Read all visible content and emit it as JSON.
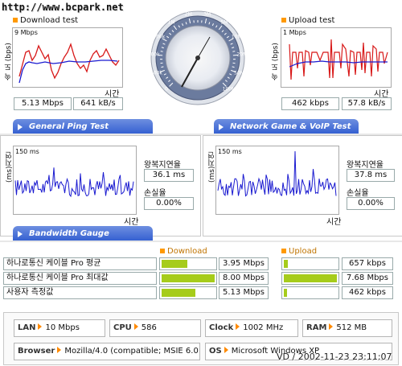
{
  "site": {
    "url": "http://www.bcpark.net"
  },
  "download": {
    "title": "Download test",
    "axis_label": "속 도 (bps)",
    "scale": "9 Mbps",
    "time_label": "시간",
    "speed_mbps": "5.13 Mbps",
    "speed_kbs": "641 kB/s"
  },
  "upload": {
    "title": "Upload test",
    "axis_label": "속 도 (bps)",
    "scale": "1 Mbps",
    "time_label": "시간",
    "speed_kbps": "462 kbps",
    "speed_kbs": "57.8 kB/s"
  },
  "gauge": {
    "ticks": [
      "0",
      "100k",
      "200k",
      "500k",
      "1M",
      "2M",
      "3M",
      "5M",
      "10M",
      "20M",
      "50M",
      "100M"
    ]
  },
  "tabs": {
    "ping": "General Ping Test",
    "game": "Network Game & VoIP Test",
    "bandwidth": "Bandwidth Gauge"
  },
  "ping_left": {
    "axis_label": "(ms)지연",
    "scale": "150 ms",
    "time_label": "시간",
    "rtt_label": "왕복지연율",
    "rtt_value": "36.1 ms",
    "loss_label": "손실율",
    "loss_value": "0.00%"
  },
  "ping_right": {
    "axis_label": "(ms)지연",
    "scale": "150 ms",
    "time_label": "시간",
    "rtt_label": "왕복지연율",
    "rtt_value": "37.8 ms",
    "loss_label": "손실율",
    "loss_value": "0.00%"
  },
  "bandwidth": {
    "download_header": "Download",
    "upload_header": "Upload",
    "rows": [
      {
        "label": "하나로통신 케이블 Pro 평균",
        "down": "3.95 Mbps",
        "down_frac": 0.49,
        "up": "657 kbps",
        "up_frac": 0.08
      },
      {
        "label": "하나로통신 케이블 Pro 최대값",
        "down": "8.00 Mbps",
        "down_frac": 1.0,
        "up": "7.68 Mbps",
        "up_frac": 1.0
      },
      {
        "label": "사용자 측정값",
        "down": "5.13 Mbps",
        "down_frac": 0.64,
        "up": "462 kbps",
        "up_frac": 0.06
      }
    ]
  },
  "sysinfo": {
    "lan_label": "LAN",
    "lan_value": "10 Mbps",
    "cpu_label": "CPU",
    "cpu_value": "586",
    "clock_label": "Clock",
    "clock_value": "1002 MHz",
    "ram_label": "RAM",
    "ram_value": "512 MB",
    "browser_label": "Browser",
    "browser_value": "Mozilla/4.0 (compatible; MSIE 6.0",
    "os_label": "OS",
    "os_value": "Microsoft Windows XP"
  },
  "watermark": "VD / 2002-11-23 23:11:07",
  "colors": {
    "tab_blue": "#3a62d4",
    "bar_green": "#a6cc1b",
    "bullet_orange": "#ff9900",
    "line_red": "#d81818",
    "line_blue": "#1a1ad0"
  }
}
